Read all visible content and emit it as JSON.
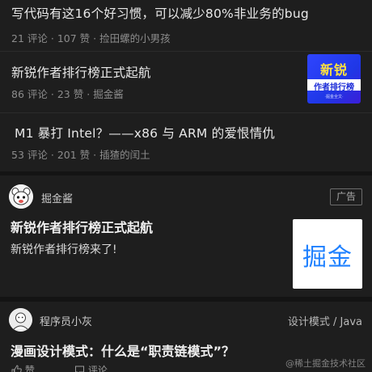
{
  "feed": [
    {
      "title": "写代码有这16个好习惯，可以减少80%非业务的bug",
      "comments": "21 评论",
      "likes": "107 赞",
      "author": "捡田螺的小男孩",
      "has_thumbnail": false
    },
    {
      "title": "新锐作者排行榜正式起航",
      "comments": "86 评论",
      "likes": "23 赞",
      "author": "掘金酱",
      "has_thumbnail": true,
      "thumbnail": {
        "line1": "新锐",
        "line2": "作者排行榜",
        "line3": "·掘金全文·",
        "bg_color": "#2f45ff",
        "accent_color": "#ffe23d"
      }
    },
    {
      "title": "M1 暴打 Intel？——x86 与 ARM 的爱恨情仇",
      "comments": "53 评论",
      "likes": "201 赞",
      "author": "插猹的闰土",
      "has_thumbnail": false
    }
  ],
  "separator": "·",
  "ad": {
    "author": "掘金酱",
    "badge": "广告",
    "title": "新锐作者排行榜正式起航",
    "description": "新锐作者排行榜来了!",
    "thumbnail_text": "掘金",
    "brand_color": "#1e80ff"
  },
  "post": {
    "author": "程序员小灰",
    "tags": "设计模式 / Java",
    "title": "漫画设计模式：什么是“职责链模式”？",
    "like_label": "赞",
    "comment_label": "评论"
  },
  "watermark": "@稀土掘金技术社区",
  "colors": {
    "background": "#161616",
    "card": "#1e1e1e",
    "text": "#e9e9e9",
    "meta": "#8c8c8c"
  }
}
